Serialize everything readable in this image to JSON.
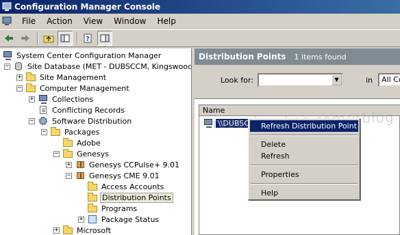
{
  "window": {
    "title": "Configuration Manager Console"
  },
  "menubar": {
    "items": [
      "File",
      "Action",
      "View",
      "Window",
      "Help"
    ]
  },
  "toolbar": {
    "buttons": [
      "back-arrow-icon",
      "forward-arrow-icon",
      "up-folder-icon",
      "show-hide-tree-icon",
      "help-icon",
      "action-pane-icon"
    ]
  },
  "tree": {
    "items": [
      {
        "label": "System Center Configuration Manager",
        "icon": "computer-icon"
      },
      {
        "label": "Site Database  (MET - DUBSCCM, Kingswood)",
        "icon": "database-icon"
      },
      {
        "label": "Site Management",
        "icon": "folder-icon"
      },
      {
        "label": "Computer Management",
        "icon": "folder-icon"
      },
      {
        "label": "Collections",
        "icon": "collections-icon"
      },
      {
        "label": "Conflicting Records",
        "icon": "document-icon"
      },
      {
        "label": "Software Distribution",
        "icon": "gear-icon"
      },
      {
        "label": "Packages",
        "icon": "folder-icon"
      },
      {
        "label": "Adobe",
        "icon": "package-folder-icon"
      },
      {
        "label": "Genesys",
        "icon": "package-folder-icon"
      },
      {
        "label": "Genesys CCPulse+ 9.01",
        "icon": "package-icon"
      },
      {
        "label": "Genesys CME 9.01",
        "icon": "package-icon"
      },
      {
        "label": "Access Accounts",
        "icon": "folder-icon"
      },
      {
        "label": "Distribution Points",
        "icon": "folder-icon"
      },
      {
        "label": "Programs",
        "icon": "folder-icon"
      },
      {
        "label": "Package Status",
        "icon": "status-icon"
      },
      {
        "label": "Microsoft",
        "icon": "package-folder-icon"
      }
    ]
  },
  "results": {
    "title": "Distribution Points",
    "count": "1 items found",
    "look_for_label": "Look for:",
    "look_for_value": "",
    "in_label": "in",
    "in_value": "All Co",
    "column_name": "Name",
    "row_label": "\\\\DUBSCC"
  },
  "context_menu": {
    "items": [
      "Refresh Distribution Point",
      "Delete",
      "Refresh",
      "Properties",
      "Help"
    ]
  },
  "watermark": "rozeniauskas.com/itblog",
  "colors": {
    "selection": "#0a246a",
    "titlebar": "#0a246a",
    "header_bar": "#808b94"
  }
}
